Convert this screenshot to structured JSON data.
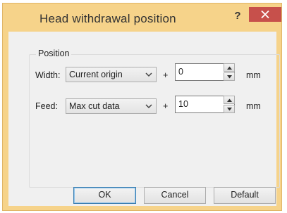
{
  "window": {
    "title": "Head withdrawal position",
    "help_label": "?"
  },
  "group": {
    "label": "Position"
  },
  "width_row": {
    "label": "Width:",
    "selected": "Current origin",
    "plus": "+",
    "value": "0",
    "unit": "mm"
  },
  "feed_row": {
    "label": "Feed:",
    "selected": "Max cut data",
    "plus": "+",
    "value": "10",
    "unit": "mm"
  },
  "buttons": {
    "ok": "OK",
    "cancel": "Cancel",
    "default": "Default"
  },
  "icons": {
    "close": "close-icon",
    "dropdown": "chevron-down-icon",
    "spin_up": "spin-up-icon",
    "spin_down": "spin-down-icon"
  },
  "colors": {
    "frame": "#f6d38a",
    "close_button": "#c7504b",
    "client": "#f0f0f0"
  }
}
